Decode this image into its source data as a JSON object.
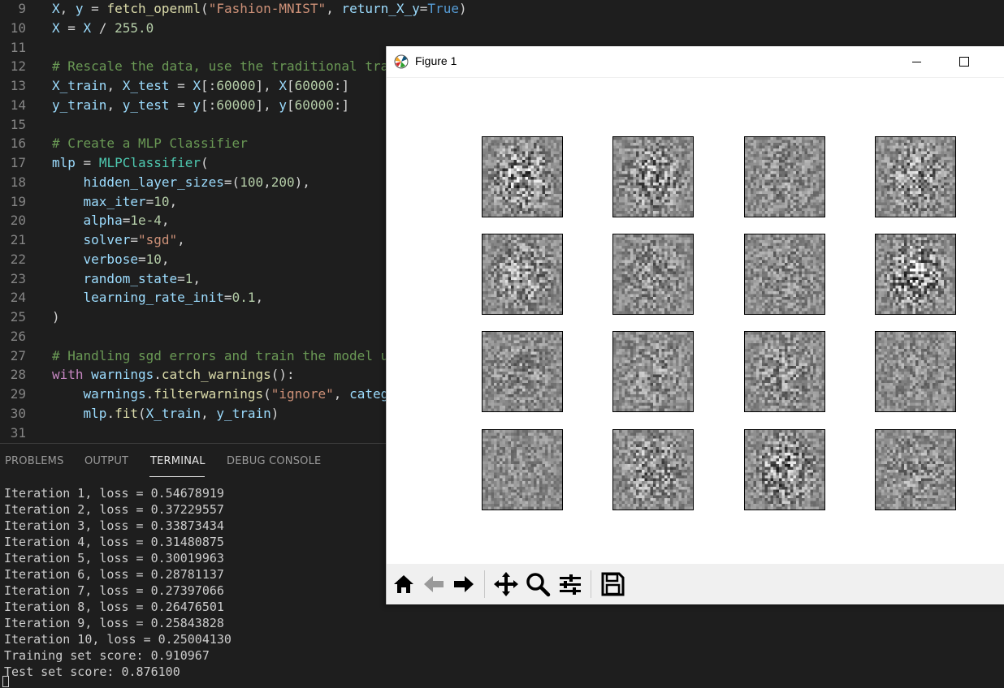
{
  "editor": {
    "lines": [
      {
        "n": "9",
        "segs": [
          [
            "X",
            "var"
          ],
          [
            ", ",
            "p"
          ],
          [
            "y",
            "var"
          ],
          [
            " = ",
            "p"
          ],
          [
            "fetch_openml",
            "fn"
          ],
          [
            "(",
            "p"
          ],
          [
            "\"Fashion-MNIST\"",
            "str"
          ],
          [
            ", ",
            "p"
          ],
          [
            "return_X_y",
            "var"
          ],
          [
            "=",
            "p"
          ],
          [
            "True",
            "const"
          ],
          [
            ")",
            "p"
          ]
        ]
      },
      {
        "n": "10",
        "segs": [
          [
            "X",
            "var"
          ],
          [
            " = ",
            "p"
          ],
          [
            "X",
            "var"
          ],
          [
            " / ",
            "p"
          ],
          [
            "255.0",
            "num"
          ]
        ]
      },
      {
        "n": "11",
        "segs": []
      },
      {
        "n": "12",
        "segs": [
          [
            "# Rescale the data, use the traditional tra",
            "cm"
          ]
        ]
      },
      {
        "n": "13",
        "segs": [
          [
            "X_train",
            "var"
          ],
          [
            ", ",
            "p"
          ],
          [
            "X_test",
            "var"
          ],
          [
            " = ",
            "p"
          ],
          [
            "X",
            "var"
          ],
          [
            "[:",
            "p"
          ],
          [
            "60000",
            "num"
          ],
          [
            "], ",
            "p"
          ],
          [
            "X",
            "var"
          ],
          [
            "[",
            "p"
          ],
          [
            "60000",
            "num"
          ],
          [
            ":]",
            "p"
          ]
        ]
      },
      {
        "n": "14",
        "segs": [
          [
            "y_train",
            "var"
          ],
          [
            ", ",
            "p"
          ],
          [
            "y_test",
            "var"
          ],
          [
            " = ",
            "p"
          ],
          [
            "y",
            "var"
          ],
          [
            "[:",
            "p"
          ],
          [
            "60000",
            "num"
          ],
          [
            "], ",
            "p"
          ],
          [
            "y",
            "var"
          ],
          [
            "[",
            "p"
          ],
          [
            "60000",
            "num"
          ],
          [
            ":]",
            "p"
          ]
        ]
      },
      {
        "n": "15",
        "segs": []
      },
      {
        "n": "16",
        "segs": [
          [
            "# Create a MLP Classifier",
            "cm"
          ]
        ]
      },
      {
        "n": "17",
        "segs": [
          [
            "mlp",
            "var"
          ],
          [
            " = ",
            "p"
          ],
          [
            "MLPClassifier",
            "cls"
          ],
          [
            "(",
            "p"
          ]
        ]
      },
      {
        "n": "18",
        "segs": [
          [
            "    ",
            "p"
          ],
          [
            "hidden_layer_sizes",
            "var"
          ],
          [
            "=(",
            "p"
          ],
          [
            "100",
            "num"
          ],
          [
            ",",
            "p"
          ],
          [
            "200",
            "num"
          ],
          [
            "),",
            "p"
          ]
        ]
      },
      {
        "n": "19",
        "segs": [
          [
            "    ",
            "p"
          ],
          [
            "max_iter",
            "var"
          ],
          [
            "=",
            "p"
          ],
          [
            "10",
            "num"
          ],
          [
            ",",
            "p"
          ]
        ]
      },
      {
        "n": "20",
        "segs": [
          [
            "    ",
            "p"
          ],
          [
            "alpha",
            "var"
          ],
          [
            "=",
            "p"
          ],
          [
            "1e-4",
            "num"
          ],
          [
            ",",
            "p"
          ]
        ]
      },
      {
        "n": "21",
        "segs": [
          [
            "    ",
            "p"
          ],
          [
            "solver",
            "var"
          ],
          [
            "=",
            "p"
          ],
          [
            "\"sgd\"",
            "str"
          ],
          [
            ",",
            "p"
          ]
        ]
      },
      {
        "n": "22",
        "segs": [
          [
            "    ",
            "p"
          ],
          [
            "verbose",
            "var"
          ],
          [
            "=",
            "p"
          ],
          [
            "10",
            "num"
          ],
          [
            ",",
            "p"
          ]
        ]
      },
      {
        "n": "23",
        "segs": [
          [
            "    ",
            "p"
          ],
          [
            "random_state",
            "var"
          ],
          [
            "=",
            "p"
          ],
          [
            "1",
            "num"
          ],
          [
            ",",
            "p"
          ]
        ]
      },
      {
        "n": "24",
        "segs": [
          [
            "    ",
            "p"
          ],
          [
            "learning_rate_init",
            "var"
          ],
          [
            "=",
            "p"
          ],
          [
            "0.1",
            "num"
          ],
          [
            ",",
            "p"
          ]
        ]
      },
      {
        "n": "25",
        "segs": [
          [
            ")",
            "p"
          ]
        ]
      },
      {
        "n": "26",
        "segs": []
      },
      {
        "n": "27",
        "segs": [
          [
            "# Handling sgd errors and train the model u",
            "cm"
          ]
        ]
      },
      {
        "n": "28",
        "segs": [
          [
            "with",
            "kw"
          ],
          [
            " ",
            "p"
          ],
          [
            "warnings",
            "var"
          ],
          [
            ".",
            "p"
          ],
          [
            "catch_warnings",
            "fn"
          ],
          [
            "():",
            "p"
          ]
        ]
      },
      {
        "n": "29",
        "segs": [
          [
            "    ",
            "p"
          ],
          [
            "warnings",
            "var"
          ],
          [
            ".",
            "p"
          ],
          [
            "filterwarnings",
            "fn"
          ],
          [
            "(",
            "p"
          ],
          [
            "\"ignore\"",
            "str"
          ],
          [
            ", ",
            "p"
          ],
          [
            "categ",
            "var"
          ]
        ]
      },
      {
        "n": "30",
        "segs": [
          [
            "    ",
            "p"
          ],
          [
            "mlp",
            "var"
          ],
          [
            ".",
            "p"
          ],
          [
            "fit",
            "fn"
          ],
          [
            "(",
            "p"
          ],
          [
            "X_train",
            "var"
          ],
          [
            ", ",
            "p"
          ],
          [
            "y_train",
            "var"
          ],
          [
            ")",
            "p"
          ]
        ]
      },
      {
        "n": "31",
        "segs": []
      }
    ]
  },
  "panel": {
    "tabs": [
      {
        "label": "PROBLEMS",
        "active": false
      },
      {
        "label": "OUTPUT",
        "active": false
      },
      {
        "label": "TERMINAL",
        "active": true
      },
      {
        "label": "DEBUG CONSOLE",
        "active": false
      }
    ],
    "terminal_lines": [
      "Iteration 1, loss = 0.54678919",
      "Iteration 2, loss = 0.37229557",
      "Iteration 3, loss = 0.33873434",
      "Iteration 4, loss = 0.31480875",
      "Iteration 5, loss = 0.30019963",
      "Iteration 6, loss = 0.28781137",
      "Iteration 7, loss = 0.27397066",
      "Iteration 8, loss = 0.26476501",
      "Iteration 9, loss = 0.25843828",
      "Iteration 10, loss = 0.25004130",
      "Training set score: 0.910967",
      "Test set score: 0.876100"
    ]
  },
  "figure_window": {
    "title": "Figure 1",
    "icon": "matplotlib-icon",
    "grid": {
      "rows": 4,
      "cols": 4
    },
    "toolbar": [
      {
        "name": "home-icon",
        "group": 0
      },
      {
        "name": "back-arrow-icon",
        "group": 0
      },
      {
        "name": "forward-arrow-icon",
        "group": 0
      },
      {
        "name": "pan-icon",
        "group": 1
      },
      {
        "name": "zoom-icon",
        "group": 1
      },
      {
        "name": "configure-subplots-icon",
        "group": 1
      },
      {
        "name": "save-icon",
        "group": 2
      }
    ]
  },
  "colors": {
    "editor_bg": "#1e1e1e",
    "comment": "#6a9955",
    "string": "#ce9178",
    "number": "#b5cea8",
    "variable": "#9cdcfe",
    "function": "#dcdcaa",
    "keyword": "#c586c0"
  }
}
